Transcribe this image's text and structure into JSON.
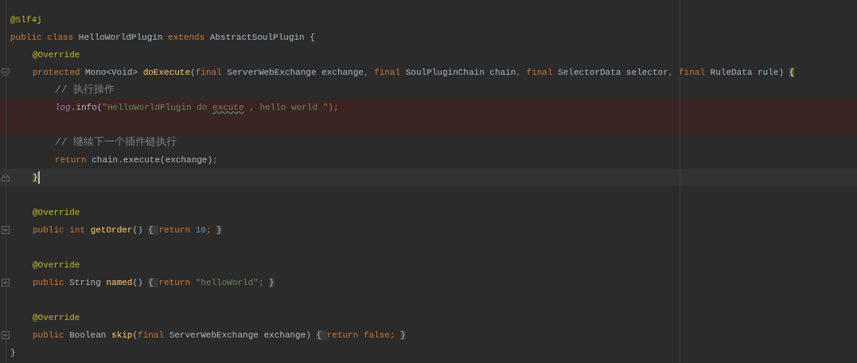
{
  "editor": {
    "lines": [
      {
        "kind": "code",
        "tokens": [
          {
            "text": "@Slf4j",
            "kind": "annotation"
          }
        ]
      },
      {
        "kind": "code",
        "tokens": [
          {
            "text": "public class ",
            "kind": "keyword"
          },
          {
            "text": "HelloWorldPlugin ",
            "kind": "plain"
          },
          {
            "text": "extends ",
            "kind": "keyword"
          },
          {
            "text": "AbstractSoulPlugin {",
            "kind": "plain"
          }
        ],
        "children": [
          {
            "kind": "code",
            "tokens": [
              {
                "text": "@Override",
                "kind": "annotation"
              }
            ]
          },
          {
            "kind": "code",
            "fold": {
              "kind": "open"
            },
            "tokens": [
              {
                "text": "protected ",
                "kind": "keyword"
              },
              {
                "text": "Mono<Void> ",
                "kind": "plain"
              },
              {
                "text": "doExecute",
                "kind": "method"
              },
              {
                "text": "(",
                "kind": "plain"
              },
              {
                "text": "final ",
                "kind": "keyword"
              },
              {
                "text": "ServerWebExchange exchange",
                "kind": "plain"
              },
              {
                "text": ", ",
                "kind": "keyword"
              },
              {
                "text": "final ",
                "kind": "keyword"
              },
              {
                "text": "SoulPluginChain chain",
                "kind": "plain"
              },
              {
                "text": ", ",
                "kind": "keyword"
              },
              {
                "text": "final ",
                "kind": "keyword"
              },
              {
                "text": "SelectorData selector",
                "kind": "plain"
              },
              {
                "text": ", ",
                "kind": "keyword"
              },
              {
                "text": "final ",
                "kind": "keyword"
              },
              {
                "text": "RuleData rule) ",
                "kind": "plain"
              },
              {
                "text": "{",
                "kind": "brace-match"
              }
            ],
            "children": [
              {
                "kind": "code",
                "tokens": [
                  {
                    "text": "// 执行操作",
                    "kind": "comment"
                  }
                ]
              },
              {
                "kind": "code",
                "highlight": {
                  "kind": "error"
                },
                "tokens": [
                  {
                    "text": "log",
                    "kind": "static"
                  },
                  {
                    "text": ".info(",
                    "kind": "plain"
                  },
                  {
                    "text": "\"HelloWorldPlugin do ",
                    "kind": "string"
                  },
                  {
                    "text": "excute",
                    "kind": "typo"
                  },
                  {
                    "text": " , hello world \"",
                    "kind": "string"
                  },
                  {
                    "text": ");",
                    "kind": "keyword"
                  }
                ]
              },
              {
                "kind": "blank",
                "highlight": {
                  "kind": "error"
                }
              },
              {
                "kind": "code",
                "tokens": [
                  {
                    "text": "// 继续下一个插件链执行",
                    "kind": "comment"
                  }
                ]
              },
              {
                "kind": "code",
                "tokens": [
                  {
                    "text": "return ",
                    "kind": "keyword"
                  },
                  {
                    "text": "chain.execute(exchange)",
                    "kind": "plain"
                  },
                  {
                    "text": ";",
                    "kind": "keyword"
                  }
                ]
              }
            ]
          },
          {
            "kind": "code",
            "fold": {
              "kind": "close"
            },
            "highlight": {
              "kind": "current"
            },
            "tokens": [
              {
                "text": "}",
                "kind": "brace-match"
              }
            ]
          },
          {
            "kind": "blank"
          },
          {
            "kind": "code",
            "tokens": [
              {
                "text": "@Override",
                "kind": "annotation"
              }
            ]
          },
          {
            "kind": "code",
            "fold": {
              "kind": "folded"
            },
            "tokens": [
              {
                "text": "public int ",
                "kind": "keyword"
              },
              {
                "text": "getOrder",
                "kind": "method"
              },
              {
                "text": "() ",
                "kind": "plain"
              },
              {
                "text": "{ ",
                "kind": "folded"
              },
              {
                "text": "return ",
                "kind": "keyword"
              },
              {
                "text": "10",
                "kind": "number"
              },
              {
                "text": "; ",
                "kind": "keyword"
              },
              {
                "text": "}",
                "kind": "folded"
              }
            ]
          },
          {
            "kind": "blank"
          },
          {
            "kind": "code",
            "tokens": [
              {
                "text": "@Override",
                "kind": "annotation"
              }
            ]
          },
          {
            "kind": "code",
            "fold": {
              "kind": "folded"
            },
            "tokens": [
              {
                "text": "public ",
                "kind": "keyword"
              },
              {
                "text": "String ",
                "kind": "plain"
              },
              {
                "text": "named",
                "kind": "method"
              },
              {
                "text": "() ",
                "kind": "plain"
              },
              {
                "text": "{ ",
                "kind": "folded"
              },
              {
                "text": "return ",
                "kind": "keyword"
              },
              {
                "text": "\"helloWorld\"",
                "kind": "string"
              },
              {
                "text": "; ",
                "kind": "keyword"
              },
              {
                "text": "}",
                "kind": "folded"
              }
            ]
          },
          {
            "kind": "blank"
          },
          {
            "kind": "code",
            "tokens": [
              {
                "text": "@Override",
                "kind": "annotation"
              }
            ]
          },
          {
            "kind": "code",
            "fold": {
              "kind": "folded"
            },
            "tokens": [
              {
                "text": "public ",
                "kind": "keyword"
              },
              {
                "text": "Boolean ",
                "kind": "plain"
              },
              {
                "text": "skip",
                "kind": "method"
              },
              {
                "text": "(",
                "kind": "plain"
              },
              {
                "text": "final ",
                "kind": "keyword"
              },
              {
                "text": "ServerWebExchange exchange) ",
                "kind": "plain"
              },
              {
                "text": "{ ",
                "kind": "folded"
              },
              {
                "text": "return false",
                "kind": "keyword"
              },
              {
                "text": "; ",
                "kind": "keyword"
              },
              {
                "text": "}",
                "kind": "folded"
              }
            ]
          }
        ]
      },
      {
        "kind": "code",
        "tokens": [
          {
            "text": "}",
            "kind": "plain"
          }
        ]
      }
    ]
  }
}
